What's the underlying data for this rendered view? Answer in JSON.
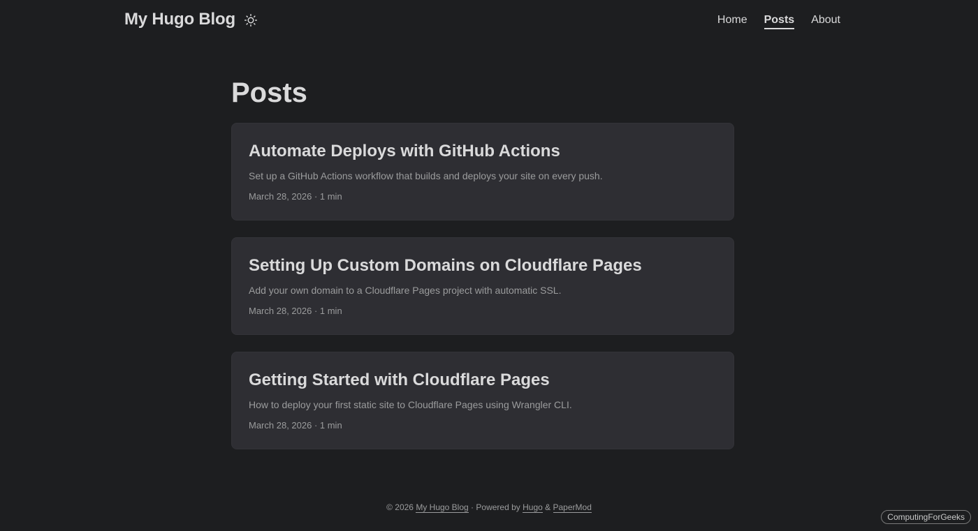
{
  "header": {
    "site_title": "My Hugo Blog",
    "theme_icon": "sun-icon",
    "nav": [
      {
        "label": "Home",
        "active": false
      },
      {
        "label": "Posts",
        "active": true
      },
      {
        "label": "About",
        "active": false
      }
    ]
  },
  "main": {
    "title": "Posts",
    "posts": [
      {
        "title": "Automate Deploys with GitHub Actions",
        "summary": "Set up a GitHub Actions workflow that builds and deploys your site on every push.",
        "meta": "March 28, 2026 · 1 min"
      },
      {
        "title": "Setting Up Custom Domains on Cloudflare Pages",
        "summary": "Add your own domain to a Cloudflare Pages project with automatic SSL.",
        "meta": "March 28, 2026 · 1 min"
      },
      {
        "title": "Getting Started with Cloudflare Pages",
        "summary": "How to deploy your first static site to Cloudflare Pages using Wrangler CLI.",
        "meta": "March 28, 2026 · 1 min"
      }
    ]
  },
  "footer": {
    "copyright": "© 2026",
    "site_link": "My Hugo Blog",
    "separator": "·",
    "powered_by": "Powered by",
    "hugo_link": "Hugo",
    "amp": "&",
    "theme_link": "PaperMod"
  },
  "watermark": "ComputingForGeeks",
  "colors": {
    "background": "#1d1e20",
    "card": "#2e2e33",
    "primary_text": "#dadadb",
    "secondary_text": "#9b9c9d"
  }
}
